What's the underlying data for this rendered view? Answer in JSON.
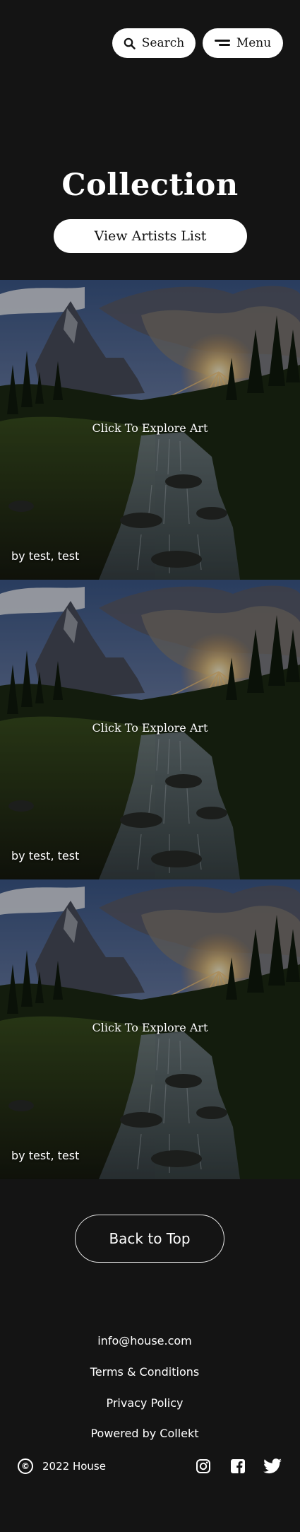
{
  "header": {
    "search_label": "Search",
    "menu_label": "Menu"
  },
  "page": {
    "title": "Collection",
    "artists_button": "View Artists List"
  },
  "cards": [
    {
      "overlay": "Click To Explore Art",
      "byline": "by test, test"
    },
    {
      "overlay": "Click To Explore Art",
      "byline": "by test, test"
    },
    {
      "overlay": "Click To Explore Art",
      "byline": "by test, test"
    }
  ],
  "footer": {
    "back_to_top": "Back to Top",
    "email": "info@house.com",
    "terms": "Terms & Conditions",
    "privacy": "Privacy Policy",
    "powered_by": "Powered by Collekt",
    "copyright_icon": "©",
    "copyright": "2022 House",
    "social_icons": [
      "instagram-icon",
      "facebook-icon",
      "twitter-icon"
    ]
  },
  "colors": {
    "background": "#141414",
    "button_bg": "#ffffff",
    "text": "#ffffff"
  }
}
